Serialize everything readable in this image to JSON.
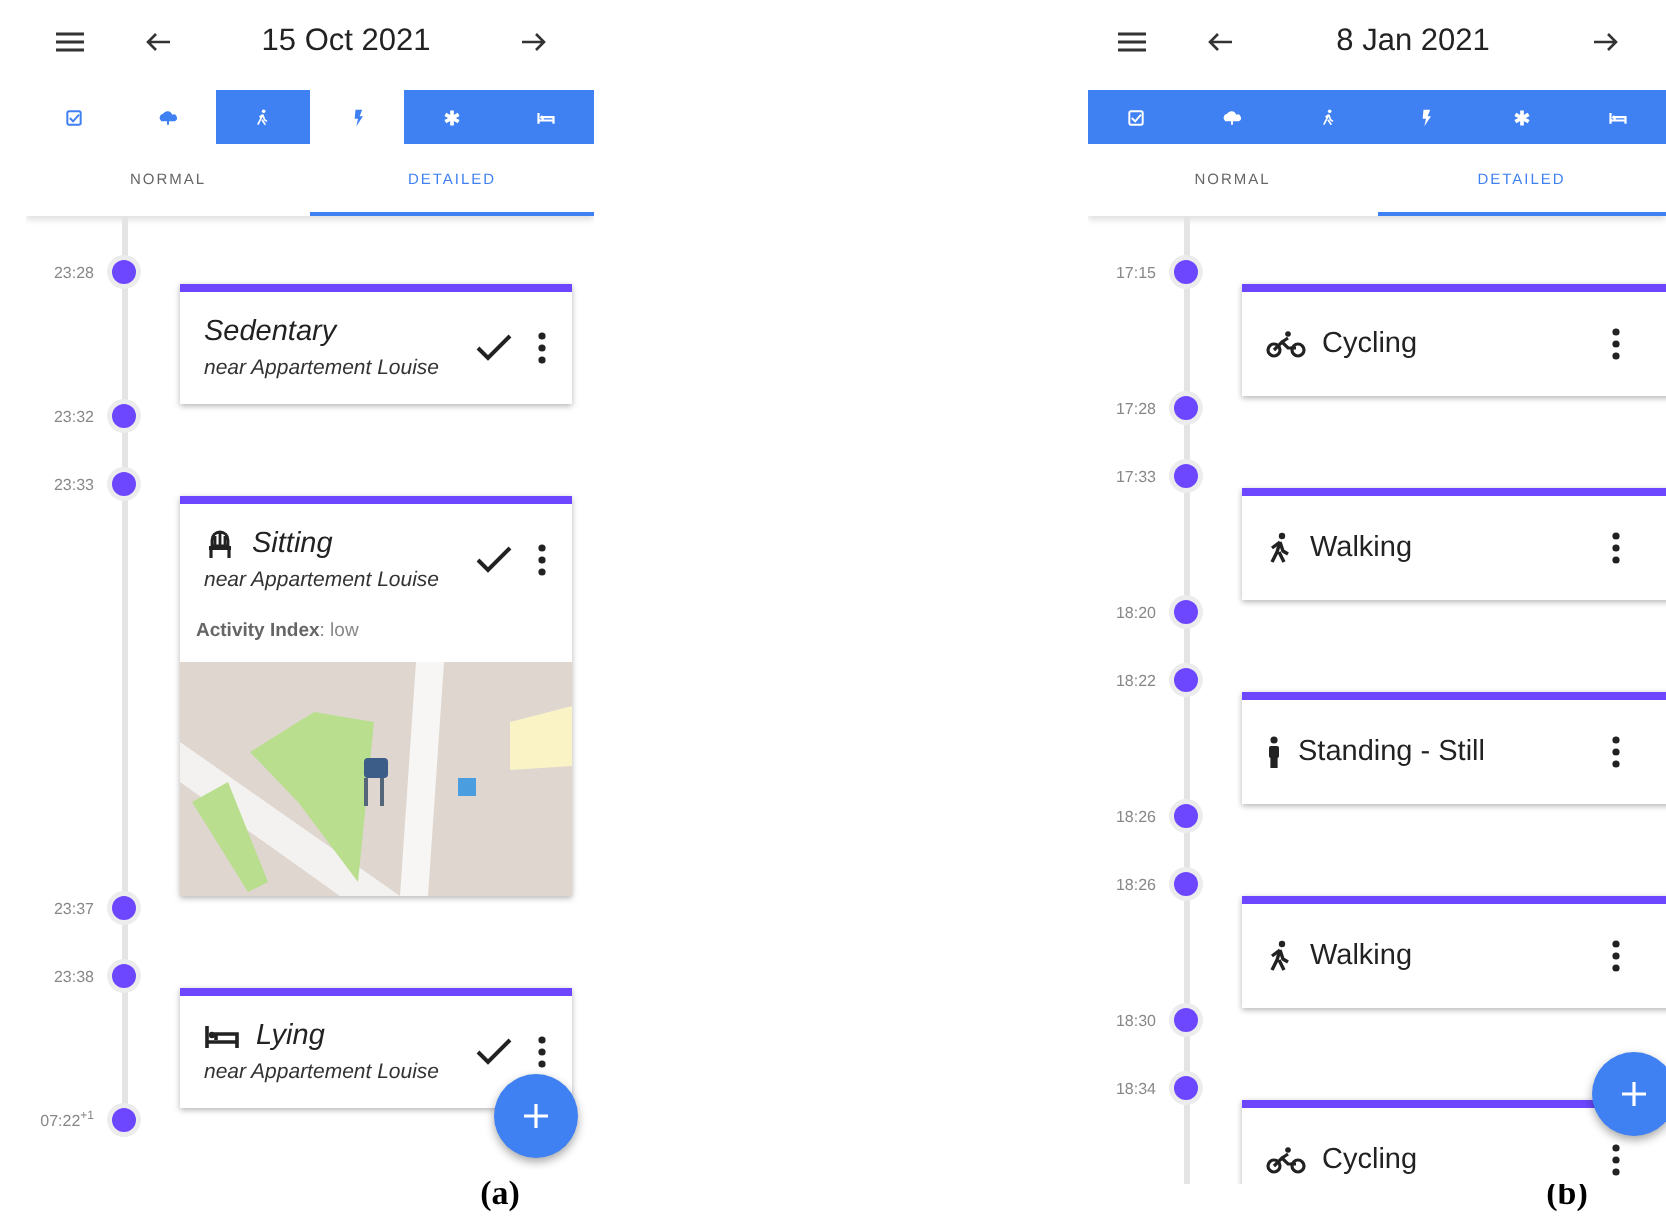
{
  "panels": [
    {
      "date": "15 Oct 2021",
      "filters": [
        {
          "selected": false
        },
        {
          "selected": false
        },
        {
          "selected": true
        },
        {
          "selected": false
        },
        {
          "selected": true
        },
        {
          "selected": true
        }
      ],
      "tabs": [
        {
          "label": "NORMAL",
          "selected": false
        },
        {
          "label": "DETAILED",
          "selected": true
        }
      ],
      "timeline": [
        {
          "kind": "time",
          "time": "23:28"
        },
        {
          "kind": "sedentary",
          "title": "Sedentary",
          "subtitle": "near Appartement Louise",
          "italic": true,
          "confirmed": true
        },
        {
          "kind": "time",
          "time": "23:32"
        },
        {
          "kind": "time",
          "time": "23:33"
        },
        {
          "kind": "sitting",
          "title": "Sitting",
          "subtitle": "near Appartement Louise",
          "italic": true,
          "confirmed": true,
          "detail": "**Activity Index**: low",
          "map": true
        },
        {
          "kind": "time",
          "time": "23:37"
        },
        {
          "kind": "time",
          "time": "23:38"
        },
        {
          "kind": "lying",
          "title": "Lying",
          "subtitle": "near Appartement Louise",
          "italic": true,
          "confirmed": true
        },
        {
          "kind": "time",
          "time": "07:22$^{+1}$"
        }
      ],
      "caption": "(a)"
    },
    {
      "date": "8 Jan 2021",
      "filters": [
        {
          "selected": true
        },
        {
          "selected": true
        },
        {
          "selected": true
        },
        {
          "selected": true
        },
        {
          "selected": true
        },
        {
          "selected": true
        }
      ],
      "tabs": [
        {
          "label": "NORMAL",
          "selected": false
        },
        {
          "label": "DETAILED",
          "selected": true
        }
      ],
      "timeline": [
        {
          "kind": "time",
          "time": "17:15"
        },
        {
          "kind": "cycling",
          "title": "Cycling",
          "italic": false,
          "confirmed": false
        },
        {
          "kind": "time",
          "time": "17:28"
        },
        {
          "kind": "time",
          "time": "17:33"
        },
        {
          "kind": "walking",
          "title": "Walking",
          "italic": false,
          "confirmed": false
        },
        {
          "kind": "time",
          "time": "18:20"
        },
        {
          "kind": "time",
          "time": "18:22"
        },
        {
          "kind": "standing",
          "title": "Standing - Still",
          "italic": false,
          "confirmed": false
        },
        {
          "kind": "time",
          "time": "18:26"
        },
        {
          "kind": "time",
          "time": "18:26"
        },
        {
          "kind": "walking",
          "title": "Walking",
          "italic": false,
          "confirmed": false
        },
        {
          "kind": "time",
          "time": "18:30"
        },
        {
          "kind": "time",
          "time": "18:34"
        },
        {
          "kind": "cycling",
          "title": "Cycling",
          "italic": false,
          "confirmed": false
        }
      ],
      "caption": "(b)"
    }
  ]
}
